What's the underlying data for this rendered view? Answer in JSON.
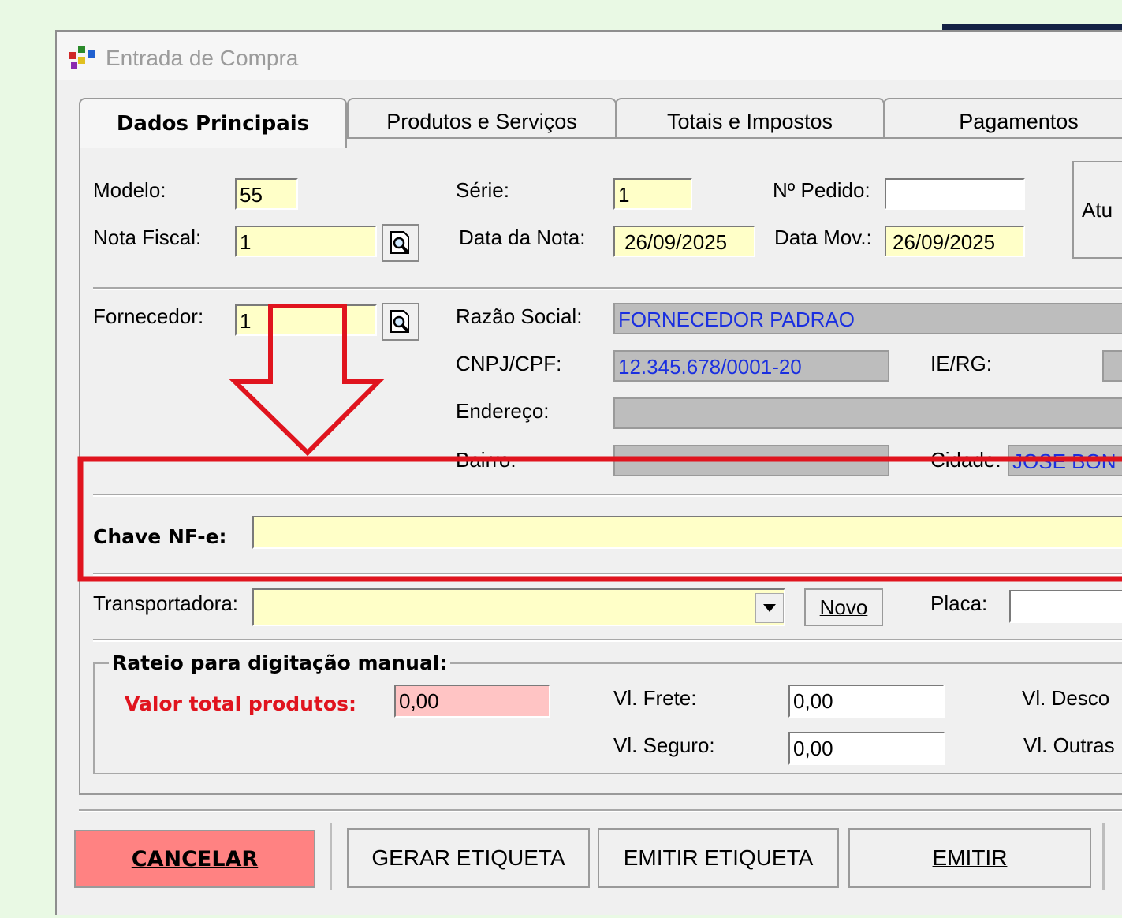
{
  "window": {
    "title": "Entrada de Compra"
  },
  "tabs": [
    "Dados Principais",
    "Produtos e Serviços",
    "Totais e Impostos",
    "Pagamentos"
  ],
  "labels": {
    "modelo": "Modelo:",
    "serie": "Série:",
    "pedido": "Nº Pedido:",
    "nota_fiscal": "Nota Fiscal:",
    "data_nota": "Data da Nota:",
    "data_mov": "Data Mov.:",
    "fornecedor": "Fornecedor:",
    "razao": "Razão Social:",
    "cnpj": "CNPJ/CPF:",
    "ie": "IE/RG:",
    "endereco": "Endereço:",
    "bairro": "Bairro:",
    "cidade": "Cidade:",
    "chave": "Chave NF-e:",
    "transportadora": "Transportadora:",
    "placa": "Placa:",
    "rateio": "Rateio para digitação manual:",
    "valor_total": "Valor total produtos:",
    "frete": "Vl. Frete:",
    "seguro": "Vl. Seguro:",
    "desconto": "Vl. Desco",
    "outras": "Vl. Outras",
    "atu": "Atu"
  },
  "values": {
    "modelo": "55",
    "serie": "1",
    "pedido": "",
    "nota_fiscal": "1",
    "data_nota": "26/09/2025",
    "data_mov": "26/09/2025",
    "fornecedor": "1",
    "razao": "FORNECEDOR PADRAO",
    "cnpj": "12.345.678/0001-20",
    "cidade": "JOSE BON",
    "chave": "",
    "transportadora": "",
    "placa": "",
    "valor_total": "0,00",
    "frete": "0,00",
    "seguro": "0,00"
  },
  "buttons": {
    "novo": "Novo",
    "cancelar": "CANCELAR",
    "gerar": "GERAR ETIQUETA",
    "emitir_etiqueta": "EMITIR ETIQUETA",
    "emitir": "EMITIR"
  },
  "colors": {
    "annotation": "#e0141e",
    "required_field": "#ffffc8",
    "cancel_button": "#ff8282",
    "readonly_text": "#1a2fe0"
  },
  "icons": [
    "app-icon",
    "lookup-icon",
    "dropdown-arrow-icon"
  ]
}
